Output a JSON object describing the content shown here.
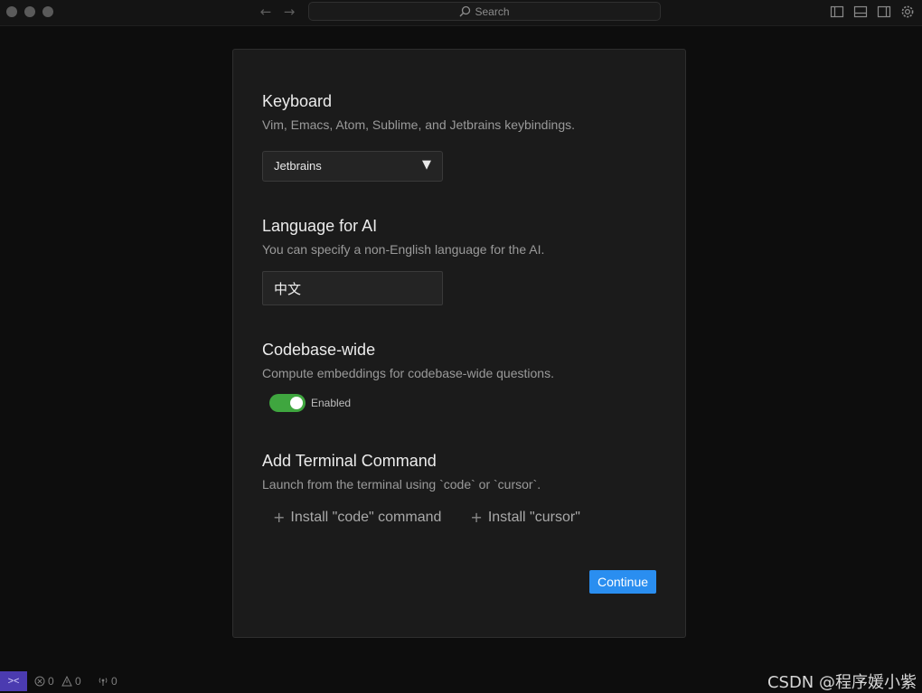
{
  "titlebar": {
    "search_label": "Search",
    "back_icon": "arrow-left-icon",
    "forward_icon": "arrow-right-icon"
  },
  "keyboard": {
    "title": "Keyboard",
    "description": "Vim, Emacs, Atom, Sublime, and Jetbrains keybindings.",
    "selected": "Jetbrains",
    "caret": "▼"
  },
  "language": {
    "title": "Language for AI",
    "description": "You can specify a non-English language for the AI.",
    "value": "中文"
  },
  "codebase": {
    "title": "Codebase-wide",
    "description": "Compute embeddings for codebase-wide questions.",
    "toggle_label": "Enabled",
    "enabled": true,
    "toggle_color": "#3fa63f"
  },
  "terminal": {
    "title": "Add Terminal Command",
    "description": "Launch from the terminal using `code` or `cursor`.",
    "install_code": "Install \"code\" command",
    "install_cursor": "Install \"cursor\"",
    "plus": "+"
  },
  "continue_label": "Continue",
  "accent_color": "#2a8ef0",
  "statusbar": {
    "errors": "0",
    "warnings": "0",
    "ports": "0",
    "watermark": "CSDN @程序媛小紫"
  }
}
